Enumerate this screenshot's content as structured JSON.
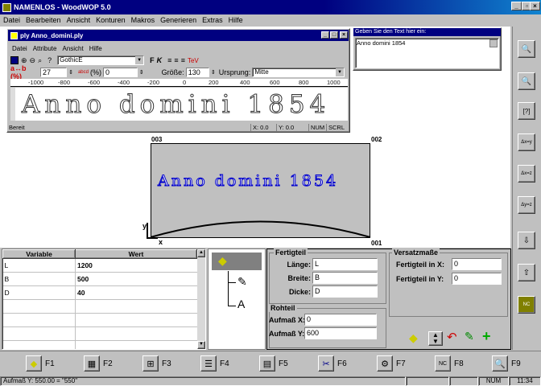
{
  "app": {
    "title": "NAMENLOS - WoodWOP 5.0"
  },
  "menu": [
    "Datei",
    "Bearbeiten",
    "Ansicht",
    "Konturen",
    "Makros",
    "Generieren",
    "Extras",
    "Hilfe"
  ],
  "doc": {
    "title": "ply Anno_domini.ply",
    "menu": [
      "Datei",
      "Attribute",
      "Ansicht",
      "Hilfe"
    ],
    "font_select": "GothicE",
    "b_label": "a↔b (%)",
    "b_value": "27",
    "abcd_label": "(%)",
    "abcd_value": "0",
    "size_label": "Größe:",
    "size_value": "130",
    "origin_label": "Ursprung:",
    "origin_value": "Mitte",
    "ruler": [
      "-1000",
      "-800",
      "-600",
      "-400",
      "-200",
      "0",
      "200",
      "400",
      "600",
      "800",
      "1000"
    ],
    "preview_text": "Anno domini 1854",
    "status": {
      "ready": "Bereit",
      "x": "X: 0.0",
      "y": "Y: 0.0",
      "num": "NUM",
      "scrl": "SCRL"
    }
  },
  "text_panel": {
    "title": "Geben Sie den Text hier ein:",
    "value": "Anno domini 1854"
  },
  "canvas": {
    "corner_tl": "003",
    "corner_tr": "002",
    "corner_br": "001",
    "workpiece_text": "Anno domini 1854",
    "axis_y": "y",
    "axis_x": "x"
  },
  "variables": {
    "headers": [
      "Variable",
      "Wert"
    ],
    "rows": [
      [
        "L",
        "1200"
      ],
      [
        "B",
        "500"
      ],
      [
        "D",
        "40"
      ],
      [
        "",
        ""
      ],
      [
        "",
        ""
      ],
      [
        "",
        ""
      ],
      [
        "",
        ""
      ]
    ]
  },
  "fertigteil": {
    "group": "Fertigteil",
    "laenge_label": "Länge:",
    "laenge": "L",
    "breite_label": "Breite:",
    "breite": "B",
    "dicke_label": "Dicke:",
    "dicke": "D"
  },
  "rohteil": {
    "group": "Rohteil",
    "aufmass_x_label": "Aufmaß X:",
    "aufmass_x": "0",
    "aufmass_y_label": "Aufmaß Y:",
    "aufmass_y": "600"
  },
  "versatz": {
    "group": "Versatzmaße",
    "x_label": "Fertigteil in X:",
    "x": "0",
    "y_label": "Fertigteil in Y:",
    "y": "0"
  },
  "fkeys": [
    "F1",
    "F2",
    "F3",
    "F4",
    "F5",
    "F6",
    "F7",
    "F8",
    "F9"
  ],
  "statusbar": {
    "message": "Aufmaß Y: 550.00 = \"550\"",
    "num": "NUM",
    "time": "11:34"
  }
}
